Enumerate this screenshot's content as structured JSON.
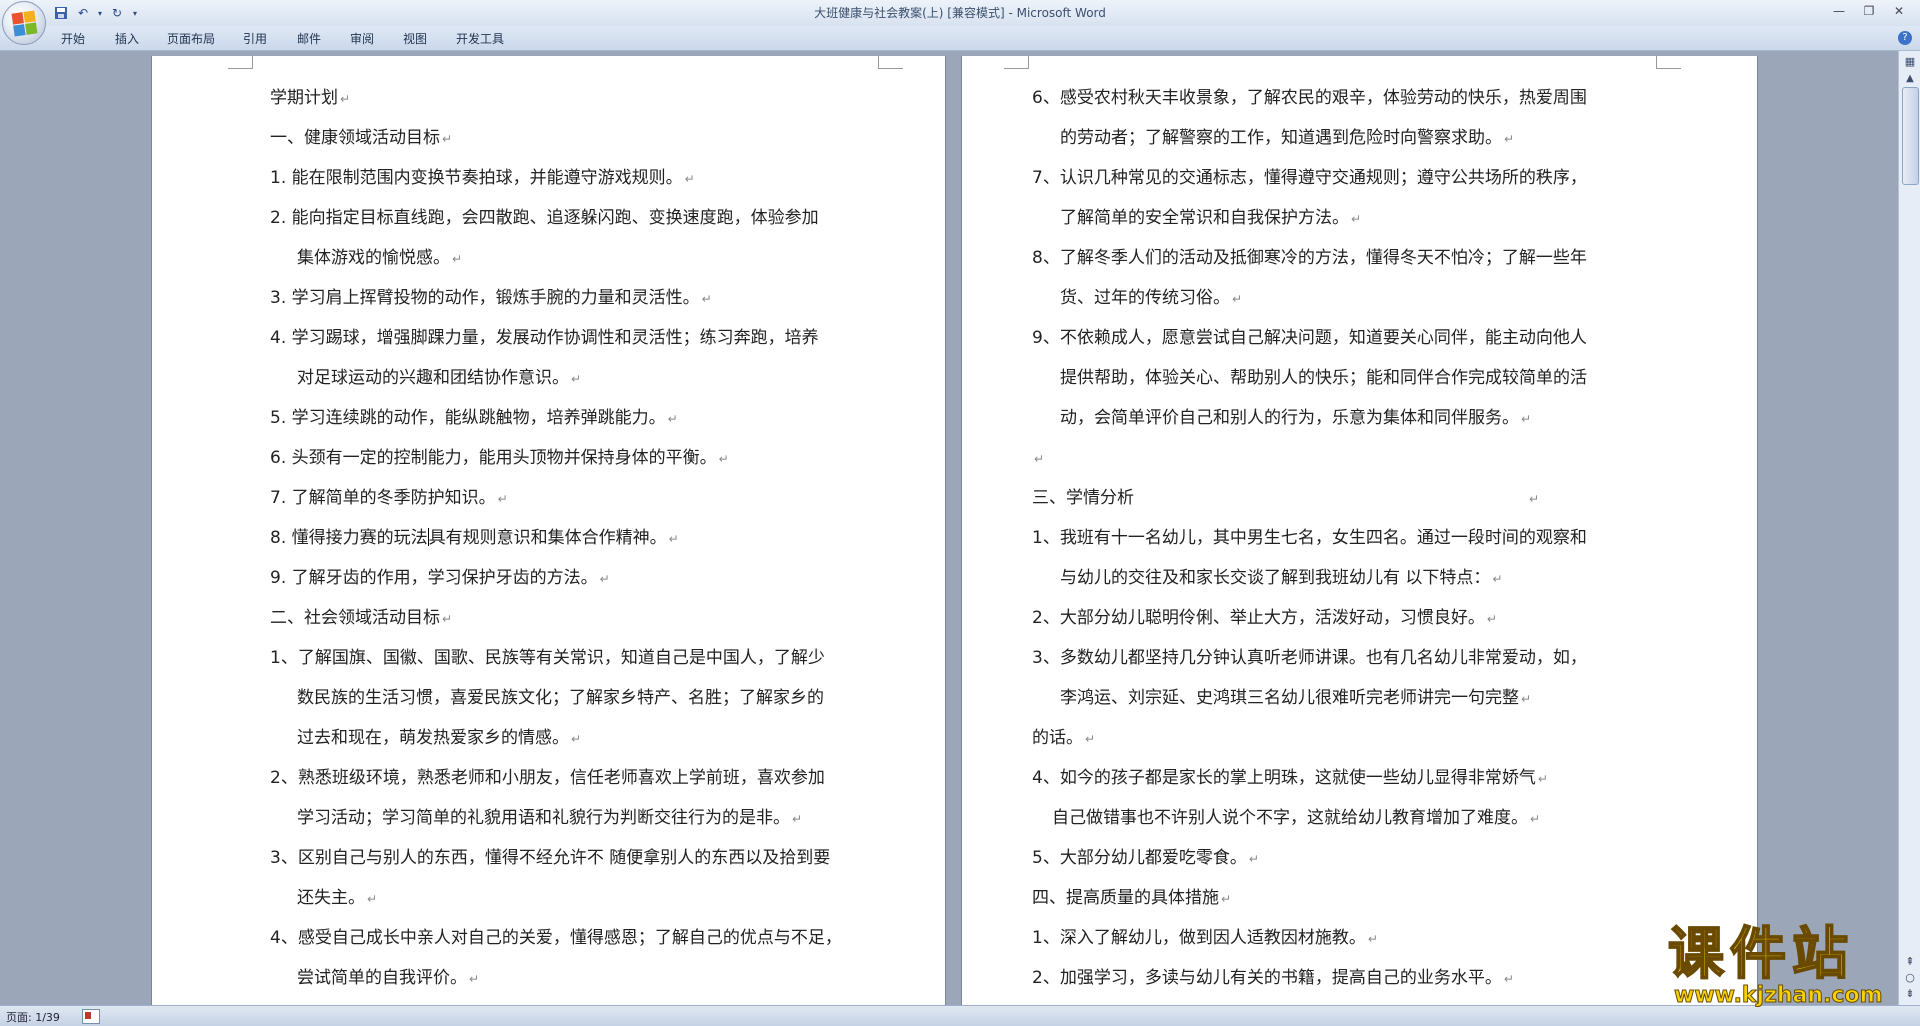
{
  "window": {
    "title": "大班健康与社会教案(上) [兼容模式] - Microsoft Word"
  },
  "ribbon": {
    "tabs": [
      "开始",
      "插入",
      "页面布局",
      "引用",
      "邮件",
      "审阅",
      "视图",
      "开发工具"
    ]
  },
  "document": {
    "left_page_lines": [
      "学期计划",
      "一、健康领域活动目标",
      "1.  能在限制范围内变换节奏拍球，并能遵守游戏规则。",
      "2.  能向指定目标直线跑，会四散跑、追逐躲闪跑、变换速度跑，体验参加",
      "集体游戏的愉悦感。",
      "3.  学习肩上挥臂投物的动作，锻炼手腕的力量和灵活性。",
      "4.  学习踢球，增强脚踝力量，发展动作协调性和灵活性；练习奔跑，培养",
      "对足球运动的兴趣和团结协作意识。",
      "5.  学习连续跳的动作，能纵跳触物，培养弹跳能力。",
      "6.  头颈有一定的控制能力，能用头顶物并保持身体的平衡。",
      "7.  了解简单的冬季防护知识。",
      "8.  懂得接力赛的玩法",
      "具有规则意识和集体合作精神。",
      "9.  了解牙齿的作用，学习保护牙齿的方法。",
      "二、社会领域活动目标",
      "1、了解国旗、国徽、国歌、民族等有关常识，知道自己是中国人，了解少",
      "数民族的生活习惯，喜爱民族文化；了解家乡特产、名胜；了解家乡的",
      "过去和现在，萌发热爱家乡的情感。",
      "2、熟悉班级环境，熟悉老师和小朋友，信任老师喜欢上学前班，喜欢参加",
      "学习活动；学习简单的礼貌用语和礼貌行为判断交往行为的是非。",
      "3、区别自己与别人的东西，懂得不经允许不  随便拿别人的东西以及拾到要",
      "还失主。",
      "4、感受自己成长中亲人对自己的关爱，懂得感恩；了解自己的优点与不足，",
      "尝试简单的自我评价。"
    ],
    "right_page_lines": [
      "6、感受农村秋天丰收景象，了解农民的艰辛，体验劳动的快乐，热爱周围",
      "的劳动者；了解警察的工作，知道遇到危险时向警察求助。",
      "7、认识几种常见的交通标志，懂得遵守交通规则；遵守公共场所的秩序，",
      "了解简单的安全常识和自我保护方法。",
      "8、了解冬季人们的活动及抵御寒冷的方法，懂得冬天不怕冷；了解一些年",
      "货、过年的传统习俗。",
      "9、不依赖成人，愿意尝试自己解决问题，知道要关心同伴，能主动向他人",
      "提供帮助，体验关心、帮助别人的快乐；能和同伴合作完成较简单的活",
      "动，会简单评价自己和别人的行为，乐意为集体和同伴服务。",
      "",
      "三、学情分析",
      "1、我班有十一名幼儿，其中男生七名，女生四名。通过一段时间的观察和",
      "与幼儿的交往及和家长交谈了解到我班幼儿有   以下特点：",
      "2、大部分幼儿聪明伶俐、举止大方，活泼好动，习惯良好。",
      "3、多数幼儿都坚持几分钟认真听老师讲课。也有几名幼儿非常爱动，如，",
      "李鸿运、刘宗延、史鸿琪三名幼儿很难听完老师讲完一句完整",
      "的话。",
      "4、如今的孩子都是家长的掌上明珠，这就使一些幼儿显得非常娇气",
      "自己做错事也不许别人说个不字，这就给幼儿教育增加了难度。",
      "5、大部分幼儿都爱吃零食。",
      "四、提高质量的具体措施",
      "1、深入了解幼儿，做到因人适教因材施教。",
      "2、加强学习，多读与幼儿有关的书籍，提高自己的业务水平。"
    ],
    "paragraph_mark": "↵"
  },
  "statusbar": {
    "page": "页面: 1/39"
  },
  "watermark": {
    "text_cn": "课件站",
    "url": "www.kjzhan.com"
  },
  "colors": {
    "office_logo": [
      "#e8542f",
      "#f3b01b",
      "#3c8fd6",
      "#7fb72a"
    ],
    "workarea": "#9ba7b8",
    "watermark_yellow": "#f7d300"
  }
}
